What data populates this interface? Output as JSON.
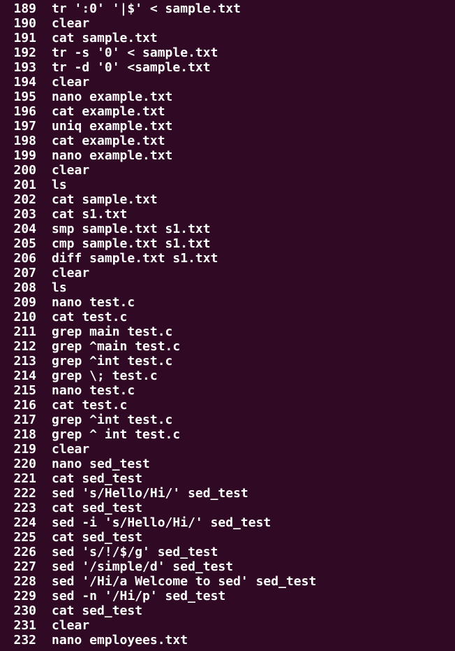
{
  "terminal": {
    "background_color": "#300a24",
    "text_color": "#ffffff",
    "history": [
      {
        "num": "189",
        "cmd": "tr ':0' '|$' < sample.txt"
      },
      {
        "num": "190",
        "cmd": "clear"
      },
      {
        "num": "191",
        "cmd": "cat sample.txt"
      },
      {
        "num": "192",
        "cmd": "tr -s '0' < sample.txt"
      },
      {
        "num": "193",
        "cmd": "tr -d '0' <sample.txt"
      },
      {
        "num": "194",
        "cmd": "clear"
      },
      {
        "num": "195",
        "cmd": "nano example.txt"
      },
      {
        "num": "196",
        "cmd": "cat example.txt"
      },
      {
        "num": "197",
        "cmd": "uniq example.txt"
      },
      {
        "num": "198",
        "cmd": "cat example.txt"
      },
      {
        "num": "199",
        "cmd": "nano example.txt"
      },
      {
        "num": "200",
        "cmd": "clear"
      },
      {
        "num": "201",
        "cmd": "ls"
      },
      {
        "num": "202",
        "cmd": "cat sample.txt"
      },
      {
        "num": "203",
        "cmd": "cat s1.txt"
      },
      {
        "num": "204",
        "cmd": "smp sample.txt s1.txt"
      },
      {
        "num": "205",
        "cmd": "cmp sample.txt s1.txt"
      },
      {
        "num": "206",
        "cmd": "diff sample.txt s1.txt"
      },
      {
        "num": "207",
        "cmd": "clear"
      },
      {
        "num": "208",
        "cmd": "ls"
      },
      {
        "num": "209",
        "cmd": "nano test.c"
      },
      {
        "num": "210",
        "cmd": "cat test.c"
      },
      {
        "num": "211",
        "cmd": "grep main test.c"
      },
      {
        "num": "212",
        "cmd": "grep ^main test.c"
      },
      {
        "num": "213",
        "cmd": "grep ^int test.c"
      },
      {
        "num": "214",
        "cmd": "grep \\; test.c"
      },
      {
        "num": "215",
        "cmd": "nano test.c"
      },
      {
        "num": "216",
        "cmd": "cat test.c"
      },
      {
        "num": "217",
        "cmd": "grep ^int test.c"
      },
      {
        "num": "218",
        "cmd": "grep ^ int test.c"
      },
      {
        "num": "219",
        "cmd": "clear"
      },
      {
        "num": "220",
        "cmd": "nano sed_test"
      },
      {
        "num": "221",
        "cmd": "cat sed_test"
      },
      {
        "num": "222",
        "cmd": "sed 's/Hello/Hi/' sed_test"
      },
      {
        "num": "223",
        "cmd": "cat sed_test"
      },
      {
        "num": "224",
        "cmd": "sed -i 's/Hello/Hi/' sed_test"
      },
      {
        "num": "225",
        "cmd": "cat sed_test"
      },
      {
        "num": "226",
        "cmd": "sed 's/!/$/g' sed_test"
      },
      {
        "num": "227",
        "cmd": "sed '/simple/d' sed_test"
      },
      {
        "num": "228",
        "cmd": "sed '/Hi/a Welcome to sed' sed_test"
      },
      {
        "num": "229",
        "cmd": "sed -n '/Hi/p' sed_test"
      },
      {
        "num": "230",
        "cmd": "cat sed_test"
      },
      {
        "num": "231",
        "cmd": "clear"
      },
      {
        "num": "232",
        "cmd": "nano employees.txt"
      }
    ]
  }
}
